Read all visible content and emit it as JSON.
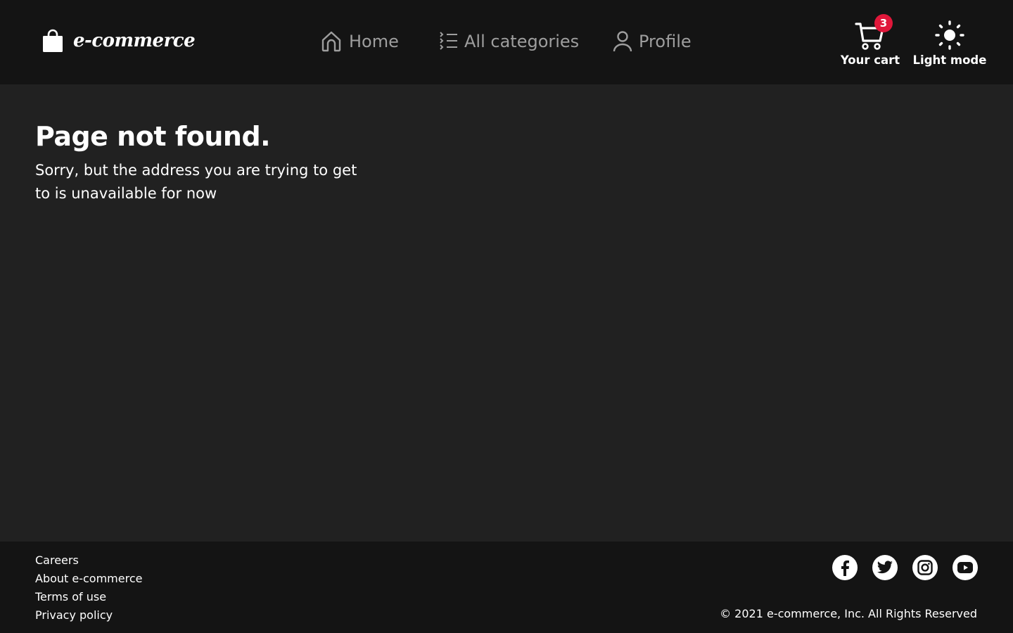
{
  "header": {
    "logo_text": "e-commerce",
    "logo_icon": "shopping-bag-icon",
    "nav": {
      "home": {
        "label": "Home",
        "icon": "home-icon"
      },
      "categories": {
        "label": "All categories",
        "icon": "list-icon"
      },
      "profile": {
        "label": "Profile",
        "icon": "user-icon"
      }
    },
    "cart": {
      "label": "Your cart",
      "count": "3",
      "icon": "cart-icon"
    },
    "theme": {
      "label": "Light mode",
      "icon": "sun-icon"
    }
  },
  "main": {
    "title": "Page not found.",
    "message": "Sorry, but the address you are trying to get to is unavailable for now"
  },
  "footer": {
    "links": [
      "Careers",
      "About e-commerce",
      "Terms of use",
      "Privacy policy"
    ],
    "socials": [
      "facebook-icon",
      "twitter-icon",
      "instagram-icon",
      "youtube-icon"
    ],
    "copyright": "© 2021 e-commerce, Inc. All Rights Reserved"
  },
  "colors": {
    "header_bg": "#141414",
    "page_bg": "#212121",
    "nav_text": "#9e9e9e",
    "badge": "#e0173a",
    "text": "#ffffff"
  }
}
